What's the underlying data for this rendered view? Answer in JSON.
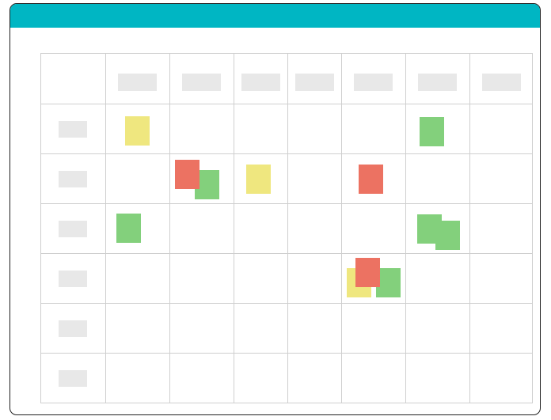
{
  "colors": {
    "titlebar": "#00b6c3",
    "yellow": "#efe77f",
    "green": "#83d07c",
    "red": "#ec7262"
  },
  "board": {
    "column_header_count": 7,
    "row_label_count": 6,
    "notes": [
      {
        "row": 1,
        "col": 1,
        "color": "yellow"
      },
      {
        "row": 1,
        "col": 6,
        "color": "green"
      },
      {
        "row": 2,
        "col": 2,
        "color": "green"
      },
      {
        "row": 2,
        "col": 2,
        "color": "red"
      },
      {
        "row": 2,
        "col": 3,
        "color": "yellow"
      },
      {
        "row": 2,
        "col": 5,
        "color": "red"
      },
      {
        "row": 3,
        "col": 1,
        "color": "green"
      },
      {
        "row": 3,
        "col": 6,
        "color": "green"
      },
      {
        "row": 3,
        "col": 6,
        "color": "green"
      },
      {
        "row": 4,
        "col": 5,
        "color": "yellow"
      },
      {
        "row": 4,
        "col": 5,
        "color": "green"
      },
      {
        "row": 4,
        "col": 5,
        "color": "red"
      }
    ]
  }
}
